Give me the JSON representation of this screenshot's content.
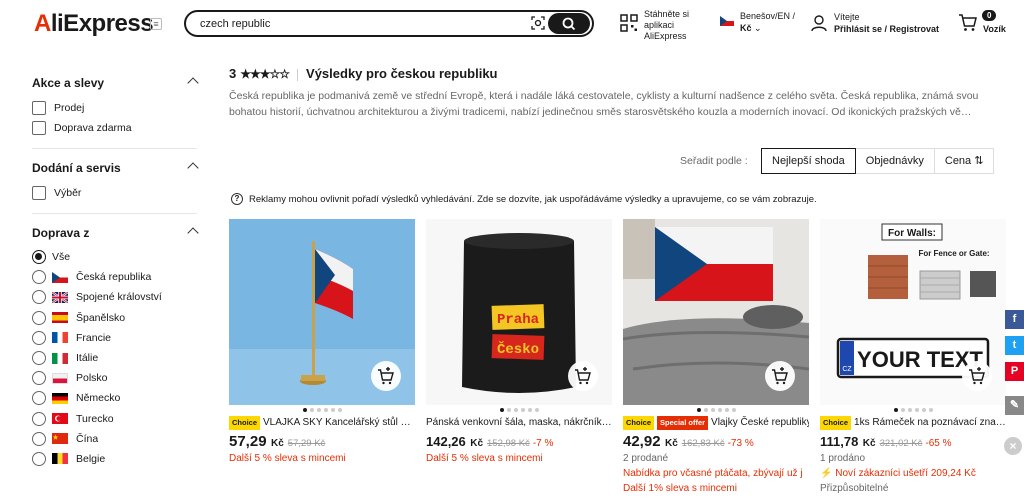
{
  "header": {
    "logo": "AliExpress",
    "search_value": "czech republic",
    "app_promo": "Stáhněte si aplikaci AliExpress",
    "locale_line1": "Benešov/EN /",
    "locale_line2": "Kč",
    "user_line1": "Vítejte",
    "user_line2": "Přihlásit se / Registrovat",
    "cart_count": "0",
    "cart_label": "Vozík"
  },
  "sidebar": {
    "deals_title": "Akce a slevy",
    "deals_items": [
      "Prodej",
      "Doprava zdarma"
    ],
    "delivery_title": "Dodání a servis",
    "delivery_items": [
      "Výběr"
    ],
    "ship_from_title": "Doprava z",
    "ship_from_items": [
      "Vše",
      "Česká republika",
      "Spojené království",
      "Španělsko",
      "Francie",
      "Itálie",
      "Polsko",
      "Německo",
      "Turecko",
      "Čína",
      "Belgie"
    ]
  },
  "main": {
    "rating_num": "3",
    "stars": "★★★☆☆",
    "title": "Výsledky pro českou republiku",
    "intro": "Česká republika je podmanivá země ve střední Evropě, která i nadále láká cestovatele, cyklisty a kulturní nadšence z celého světa. Česká republika, známá svou bohatou historií, úchvatnou architekturou a živými tradicemi, nabízí jedinečnou směs starosvětského kouzla a moderních inovací. Od ikonických pražských vě…",
    "sort_label": "Seřadit podle :",
    "sort_options": [
      "Nejlepší shoda",
      "Objednávky",
      "Cena ⇅"
    ],
    "ads_note": "Reklamy mohou ovlivnit pořadí výsledků vyhledávání. Zde se dozvíte, jak uspořádáváme výsledky a upravujeme, co se vám zobrazuje."
  },
  "products": [
    {
      "badges": [
        "Choice"
      ],
      "title": "VLAJKA SKY Kancelářský stůl …",
      "price": "57,29",
      "currency": "Kč",
      "old_price": "57,29 Kč",
      "discount": "",
      "line1": "Další 5 % sleva s mincemi",
      "line1_color": "red",
      "line2": "",
      "line3": ""
    },
    {
      "badges": [],
      "title": "Pánská venkovní šála, maska, nákrčník…",
      "price": "142,26",
      "currency": "Kč",
      "old_price": "152,98 Kč",
      "discount": "-7 %",
      "line1": "Další 5 % sleva s mincemi",
      "line1_color": "red",
      "line2": "",
      "line3": ""
    },
    {
      "badges": [
        "Choice",
        "Special offer"
      ],
      "title": "Vlajky České republiky…",
      "price": "42,92",
      "currency": "Kč",
      "old_price": "162,83 Kč",
      "discount": "-73 %",
      "line1": "2 prodané",
      "line1_color": "gray",
      "line2": "Nabídka pro včasné ptáčata, zbývají už j",
      "line3": "Další 1% sleva s mincemi"
    },
    {
      "badges": [
        "Choice"
      ],
      "title": "1ks Rámeček na poznávací zna…",
      "price": "111,78",
      "currency": "Kč",
      "old_price": "321,02 Kč",
      "discount": "-65 %",
      "line1": "1 prodáno",
      "line1_color": "gray",
      "line2": "⚡ Noví zákazníci ušetří 209,24 Kč",
      "line3": "Přizpůsobitelné"
    }
  ],
  "product_images": {
    "p2_text_top": "Praha",
    "p2_text_bottom": "Česko",
    "p4_for_walls": "For Walls:",
    "p4_for_fence": "For Fence or Gate:",
    "p4_plate": "YOUR TEXT",
    "p4_plate_code": "CZ"
  },
  "social": [
    "f",
    "t",
    "P",
    "✎"
  ]
}
